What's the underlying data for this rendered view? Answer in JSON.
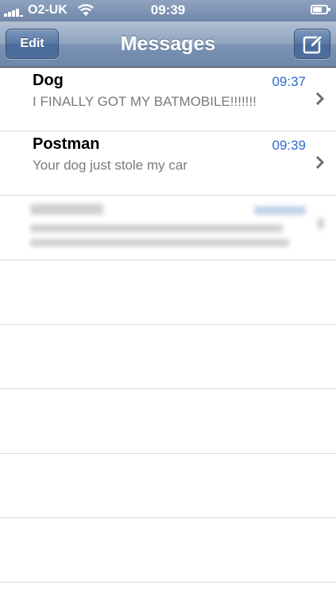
{
  "status_bar": {
    "carrier": "O2-UK",
    "time": "09:39",
    "battery_level_percent": 70
  },
  "nav_bar": {
    "edit_label": "Edit",
    "title": "Messages",
    "compose_icon": "compose-icon"
  },
  "colors": {
    "accent_blue": "#2f6bd2",
    "nav_blue": "#6d87aa",
    "preview_gray": "#7a7a7a"
  },
  "conversations": [
    {
      "sender": "Dog",
      "time": "09:37",
      "preview": "I FINALLY GOT MY BATMOBILE!!!!!!!"
    },
    {
      "sender": "Postman",
      "time": "09:39",
      "preview": "Your dog just stole my car"
    }
  ]
}
